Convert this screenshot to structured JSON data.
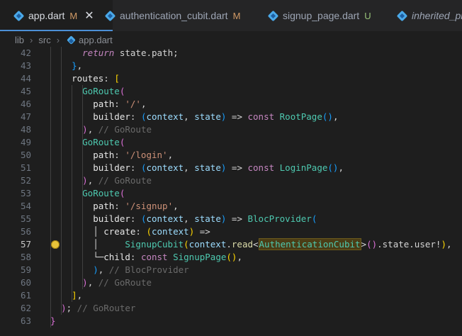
{
  "tabs": [
    {
      "label": "app.dart",
      "badge": "M",
      "active": true,
      "closable": true
    },
    {
      "label": "authentication_cubit.dart",
      "badge": "M",
      "active": false
    },
    {
      "label": "signup_page.dart",
      "badge": "U",
      "active": false
    },
    {
      "label": "inherited_pr",
      "badge": "",
      "active": false
    }
  ],
  "breadcrumb": [
    "lib",
    "src",
    "app.dart"
  ],
  "editor": {
    "current_line": 57,
    "lines": [
      {
        "n": 42,
        "indent": 4,
        "tokens": [
          [
            "t-ctrl",
            "return"
          ],
          [
            "t-plain",
            " state.path;"
          ]
        ]
      },
      {
        "n": 43,
        "indent": 3,
        "tokens": [
          [
            "t-b3",
            "}"
          ],
          [
            "t-plain",
            ","
          ]
        ]
      },
      {
        "n": 44,
        "indent": 3,
        "tokens": [
          [
            "t-prop",
            "routes"
          ],
          [
            "t-plain",
            ": "
          ],
          [
            "t-b1",
            "["
          ]
        ]
      },
      {
        "n": 45,
        "indent": 4,
        "tokens": [
          [
            "t-type",
            "GoRoute"
          ],
          [
            "t-b2",
            "("
          ]
        ]
      },
      {
        "n": 46,
        "indent": 5,
        "tokens": [
          [
            "t-prop",
            "path"
          ],
          [
            "t-plain",
            ": "
          ],
          [
            "t-str",
            "'/'"
          ],
          [
            "t-plain",
            ","
          ]
        ]
      },
      {
        "n": 47,
        "indent": 5,
        "tokens": [
          [
            "t-prop",
            "builder"
          ],
          [
            "t-plain",
            ": "
          ],
          [
            "t-b3",
            "("
          ],
          [
            "t-var",
            "context"
          ],
          [
            "t-plain",
            ", "
          ],
          [
            "t-var",
            "state"
          ],
          [
            "t-b3",
            ")"
          ],
          [
            "t-plain",
            " => "
          ],
          [
            "t-kw",
            "const "
          ],
          [
            "t-type",
            "RootPage"
          ],
          [
            "t-b3",
            "()"
          ],
          [
            "t-plain",
            ","
          ]
        ]
      },
      {
        "n": 48,
        "indent": 4,
        "tokens": [
          [
            "t-b2",
            ")"
          ],
          [
            "t-plain",
            ", "
          ],
          [
            "t-cmt",
            "// GoRoute"
          ]
        ]
      },
      {
        "n": 49,
        "indent": 4,
        "tokens": [
          [
            "t-type",
            "GoRoute"
          ],
          [
            "t-b2",
            "("
          ]
        ]
      },
      {
        "n": 50,
        "indent": 5,
        "tokens": [
          [
            "t-prop",
            "path"
          ],
          [
            "t-plain",
            ": "
          ],
          [
            "t-str",
            "'/login'"
          ],
          [
            "t-plain",
            ","
          ]
        ]
      },
      {
        "n": 51,
        "indent": 5,
        "tokens": [
          [
            "t-prop",
            "builder"
          ],
          [
            "t-plain",
            ": "
          ],
          [
            "t-b3",
            "("
          ],
          [
            "t-var",
            "context"
          ],
          [
            "t-plain",
            ", "
          ],
          [
            "t-var",
            "state"
          ],
          [
            "t-b3",
            ")"
          ],
          [
            "t-plain",
            " => "
          ],
          [
            "t-kw",
            "const "
          ],
          [
            "t-type",
            "LoginPage"
          ],
          [
            "t-b3",
            "()"
          ],
          [
            "t-plain",
            ","
          ]
        ]
      },
      {
        "n": 52,
        "indent": 4,
        "tokens": [
          [
            "t-b2",
            ")"
          ],
          [
            "t-plain",
            ", "
          ],
          [
            "t-cmt",
            "// GoRoute"
          ]
        ]
      },
      {
        "n": 53,
        "indent": 4,
        "tokens": [
          [
            "t-type",
            "GoRoute"
          ],
          [
            "t-b2",
            "("
          ]
        ]
      },
      {
        "n": 54,
        "indent": 5,
        "tokens": [
          [
            "t-prop",
            "path"
          ],
          [
            "t-plain",
            ": "
          ],
          [
            "t-str",
            "'/signup'"
          ],
          [
            "t-plain",
            ","
          ]
        ]
      },
      {
        "n": 55,
        "indent": 5,
        "tokens": [
          [
            "t-prop",
            "builder"
          ],
          [
            "t-plain",
            ": "
          ],
          [
            "t-b3",
            "("
          ],
          [
            "t-var",
            "context"
          ],
          [
            "t-plain",
            ", "
          ],
          [
            "t-var",
            "state"
          ],
          [
            "t-b3",
            ")"
          ],
          [
            "t-plain",
            " => "
          ],
          [
            "t-type",
            "BlocProvider"
          ],
          [
            "t-b3",
            "("
          ]
        ]
      },
      {
        "n": 56,
        "indent": 5,
        "tokens": [
          [
            "t-plain",
            "│ "
          ],
          [
            "t-prop",
            "create"
          ],
          [
            "t-plain",
            ": "
          ],
          [
            "t-b1",
            "("
          ],
          [
            "t-var",
            "context"
          ],
          [
            "t-b1",
            ")"
          ],
          [
            "t-plain",
            " =>"
          ]
        ]
      },
      {
        "n": 57,
        "indent": 5,
        "tokens": [
          [
            "t-plain",
            "│     "
          ],
          [
            "t-type",
            "SignupCubit"
          ],
          [
            "t-b1",
            "("
          ],
          [
            "t-var",
            "context"
          ],
          [
            "t-plain",
            "."
          ],
          [
            "t-fn",
            "read"
          ],
          [
            "t-plain",
            "<"
          ],
          [
            "t-type t-hl",
            "AuthenticationCubit"
          ],
          [
            "t-plain",
            ">"
          ],
          [
            "t-b2",
            "()"
          ],
          [
            "t-plain",
            ".state.user!"
          ],
          [
            "t-b1",
            ")"
          ],
          [
            "t-plain",
            ","
          ]
        ]
      },
      {
        "n": 58,
        "indent": 5,
        "tokens": [
          [
            "t-plain",
            "└─"
          ],
          [
            "t-prop",
            "child"
          ],
          [
            "t-plain",
            ": "
          ],
          [
            "t-kw",
            "const "
          ],
          [
            "t-type",
            "SignupPage"
          ],
          [
            "t-b1",
            "()"
          ],
          [
            "t-plain",
            ","
          ]
        ]
      },
      {
        "n": 59,
        "indent": 5,
        "tokens": [
          [
            "t-b3",
            ")"
          ],
          [
            "t-plain",
            ", "
          ],
          [
            "t-cmt",
            "// BlocProvider"
          ]
        ]
      },
      {
        "n": 60,
        "indent": 4,
        "tokens": [
          [
            "t-b2",
            ")"
          ],
          [
            "t-plain",
            ", "
          ],
          [
            "t-cmt",
            "// GoRoute"
          ]
        ]
      },
      {
        "n": 61,
        "indent": 3,
        "tokens": [
          [
            "t-b1",
            "]"
          ],
          [
            "t-plain",
            ","
          ]
        ]
      },
      {
        "n": 62,
        "indent": 2,
        "tokens": [
          [
            "t-b2",
            ")"
          ],
          [
            "t-plain",
            "; "
          ],
          [
            "t-cmt",
            "// GoRouter"
          ]
        ]
      },
      {
        "n": 63,
        "indent": 1,
        "tokens": [
          [
            "t-b2",
            "}"
          ]
        ]
      }
    ]
  }
}
